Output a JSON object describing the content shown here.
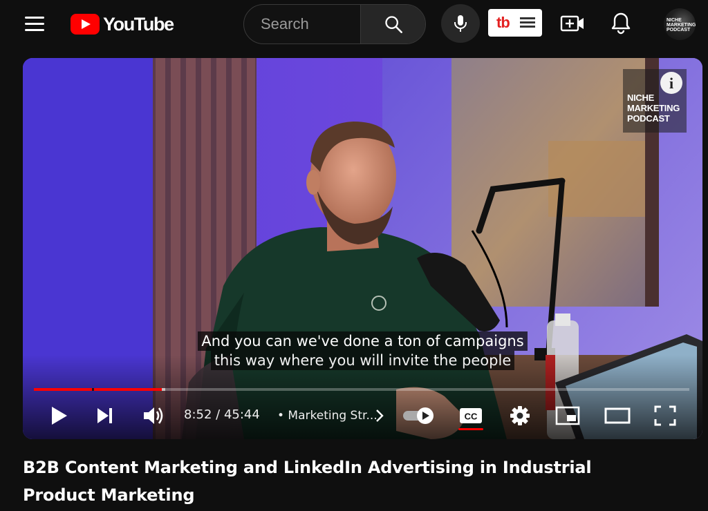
{
  "header": {
    "logo_text": "YouTube",
    "search_placeholder": "Search",
    "extension_label": "tb",
    "avatar_text": "NICHE MARKETING PODCAST"
  },
  "player": {
    "watermark_text": "NICHE MARKETING PODCAST",
    "info_label": "i",
    "captions": [
      "And you can we've done a ton of campaigns",
      "this way where you will invite the people"
    ],
    "time_current": "8:52",
    "time_separator": " / ",
    "time_total": "45:44",
    "chapter": "• Marketing Str...",
    "progress_played": 0.195,
    "progress_buffered": 0.2,
    "cc_enabled": true,
    "accent_color": "#ff0000"
  },
  "video": {
    "title": "B2B Content Marketing and LinkedIn Advertising in Industrial Product Marketing"
  }
}
